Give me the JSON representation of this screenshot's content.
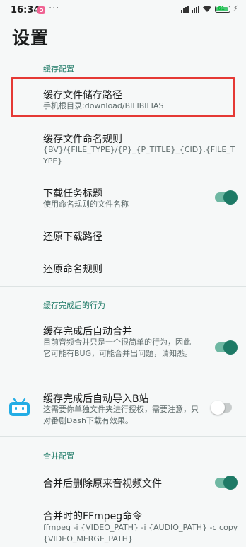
{
  "status_bar": {
    "time": "16:34",
    "more": "···",
    "battery": "61"
  },
  "page_title": "设置",
  "sections": {
    "cache_config": "缓存配置",
    "after_cache": "缓存完成后的行为",
    "merge_config": "合并配置"
  },
  "items": {
    "storage_path": {
      "title": "缓存文件储存路径",
      "subtitle": "手机根目录:download/BILIBILIAS"
    },
    "naming_rule": {
      "title": "缓存文件命名规则",
      "subtitle": "{BV}/{FILE_TYPE}/{P}_{P_TITLE}_{CID}.{FILE_TYPE}"
    },
    "download_task_title": {
      "title": "下载任务标题",
      "subtitle": "使用命名规则的文件名称",
      "enabled": true
    },
    "restore_download_path": {
      "title": "还原下载路径"
    },
    "restore_naming_rule": {
      "title": "还原命名规则"
    },
    "auto_merge": {
      "title": "缓存完成后自动合并",
      "subtitle": "目前音频合并只是一个很简单的行为，因此它可能有BUG，可能合并出问题，请知悉。",
      "enabled": true
    },
    "auto_import_bili": {
      "title": "缓存完成后自动导入B站",
      "subtitle": "这需要你单独文件夹进行授权，需要注意，只对番剧Dash下载有效果。",
      "enabled": false
    },
    "delete_after_merge": {
      "title": "合并后删除原来音视频文件",
      "enabled": true
    },
    "ffmpeg_command": {
      "title": "合并时的FFmpeg命令",
      "subtitle": "ffmpeg -i {VIDEO_PATH} -i {AUDIO_PATH} -c copy {VIDEO_MERGE_PATH}"
    }
  },
  "colors": {
    "accent": "#1e7a66",
    "highlight": "#e53935",
    "bili_icon": "#23ade5"
  }
}
